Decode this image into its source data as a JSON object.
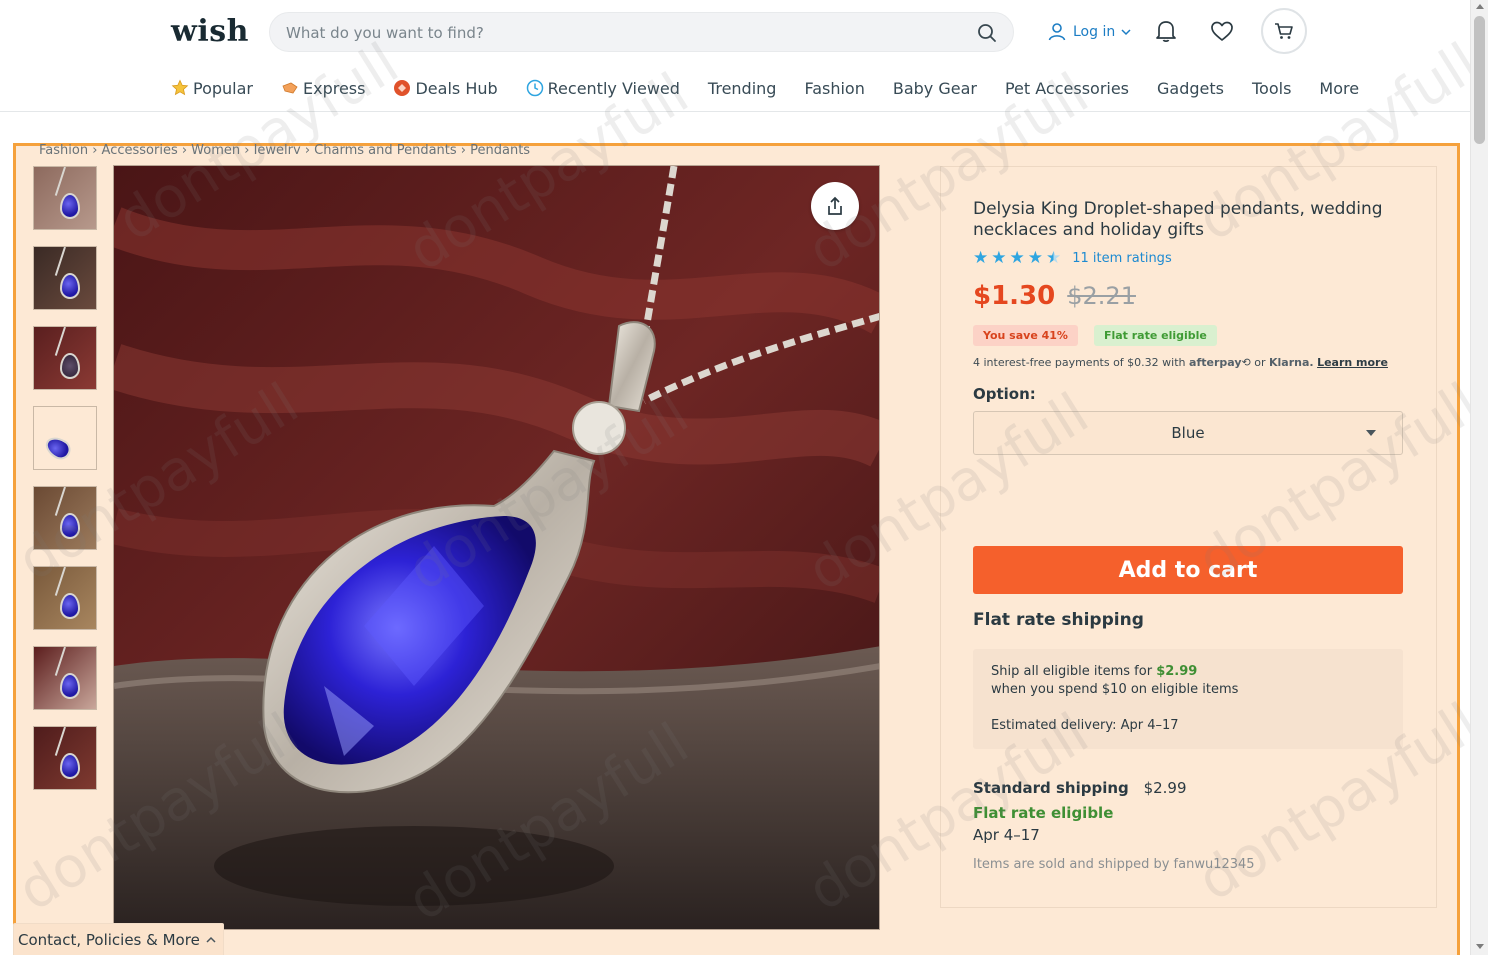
{
  "header": {
    "logo": "wish",
    "search_placeholder": "What do you want to find?",
    "login_label": "Log in"
  },
  "nav": [
    {
      "label": "Popular",
      "icon": "star-icon"
    },
    {
      "label": "Express",
      "icon": "express-icon"
    },
    {
      "label": "Deals Hub",
      "icon": "deals-icon"
    },
    {
      "label": "Recently Viewed",
      "icon": "clock-icon"
    },
    {
      "label": "Trending"
    },
    {
      "label": "Fashion"
    },
    {
      "label": "Baby Gear"
    },
    {
      "label": "Pet Accessories"
    },
    {
      "label": "Gadgets"
    },
    {
      "label": "Tools"
    },
    {
      "label": "More"
    }
  ],
  "breadcrumb": "Fashion › Accessories › Women › Jewelry › Charms and Pendants › Pendants",
  "product": {
    "title": "Delysia King  Droplet-shaped pendants, wedding necklaces and holiday gifts",
    "rating_stars": 4.5,
    "rating_count": "11 item ratings",
    "price": "$1.30",
    "original_price": "$2.21",
    "save_badge": "You save 41%",
    "flat_badge": "Flat rate eligible",
    "installments_prefix": "4 interest-free payments of $0.32 with",
    "afterpay": "afterpay",
    "or": "or",
    "klarna": "Klarna.",
    "learn_more": "Learn more",
    "option_label": "Option:",
    "option_value": "Blue",
    "add_to_cart": "Add to cart"
  },
  "shipping": {
    "flat_title": "Flat rate shipping",
    "flat_line1_prefix": "Ship all eligible items for",
    "flat_line1_amount": "$2.99",
    "flat_line2": "when you spend $10 on eligible items",
    "flat_line3": "Estimated delivery: Apr 4–17",
    "standard_name": "Standard shipping",
    "standard_price": "$2.99",
    "standard_eligible": "Flat rate eligible",
    "standard_dates": "Apr 4–17",
    "sold_by": "Items are sold and shipped by fanwu12345"
  },
  "footer_tab": "Contact, Policies & More",
  "watermark": "dontpayfull",
  "colors": {
    "accent": "#f5602c",
    "price": "#e5471f",
    "link": "#1d8ad1",
    "green": "#3f8f34",
    "highlight": "#fde9d5",
    "highlight_border": "#f5a13c"
  }
}
